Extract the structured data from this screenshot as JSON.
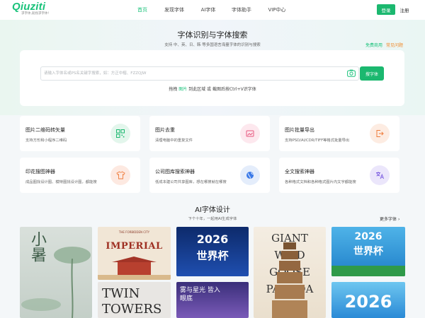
{
  "header": {
    "logo_text": "Qiuziti",
    "logo_tagline": "求字体,就找求字体!",
    "nav": [
      {
        "label": "首页",
        "active": true
      },
      {
        "label": "发现字体",
        "active": false
      },
      {
        "label": "AI字体",
        "active": false
      },
      {
        "label": "字体助手",
        "active": false
      },
      {
        "label": "VIP中心",
        "active": false
      }
    ],
    "login_label": "登录",
    "register_label": "注册"
  },
  "hero": {
    "title": "字体识别与字体搜索",
    "subtitle": "支持 中、英、日、韩 等多国语言海量字体的识别与搜索",
    "link_free": "免费商用",
    "link_faq": "常见问题",
    "search_placeholder": "请输入字体名或PS名关键字搜索，如：方正中楷、FZZQJW",
    "search_button": "搜字体",
    "drag_pre": "拖拽",
    "drag_highlight": "图片",
    "drag_post": "到此区域 或 截图后按Ctrl+V识字体"
  },
  "tools": [
    {
      "title": "图片二维码转矢量",
      "desc": "支持方形和小程序二维码",
      "icon": "qrcode-icon"
    },
    {
      "title": "图片去重",
      "desc": "清理电脑中的重复文件",
      "icon": "image-dedupe-icon"
    },
    {
      "title": "图片批量导出",
      "desc": "支持PSD/AI/CDR/TIFF等格式批量导出",
      "icon": "export-icon"
    },
    {
      "title": "印花搜图神器",
      "desc": "成品图找设计图、模特图找设计图，都能搜",
      "icon": "tshirt-icon"
    },
    {
      "title": "公司图库搜索神器",
      "desc": "低成本建公司共享图库，想在哪搜就在哪搜",
      "icon": "globe-icon"
    },
    {
      "title": "全文搜索神器",
      "desc": "各种格式文档和各种格式图片内文字都能搜",
      "icon": "translate-icon"
    }
  ],
  "ai": {
    "title": "AI字体设计",
    "subtitle": "下个十年，一起用AI生成字体",
    "more_label": "更多字体",
    "thumbs": [
      {
        "text": "小暑"
      },
      {
        "text": "IMPERIAL",
        "subtext": "THE FORBIDDEN CITY"
      },
      {
        "text": "2026",
        "subtext": "世界杯"
      },
      {
        "text": "GIANT WILD GOOSE PAGODA"
      },
      {
        "text": "2026",
        "subtext": "世界杯"
      },
      {
        "text": "TWIN TOWERS"
      },
      {
        "text": "雾与星光 皆入眼底"
      },
      {
        "text": "2026"
      }
    ]
  }
}
